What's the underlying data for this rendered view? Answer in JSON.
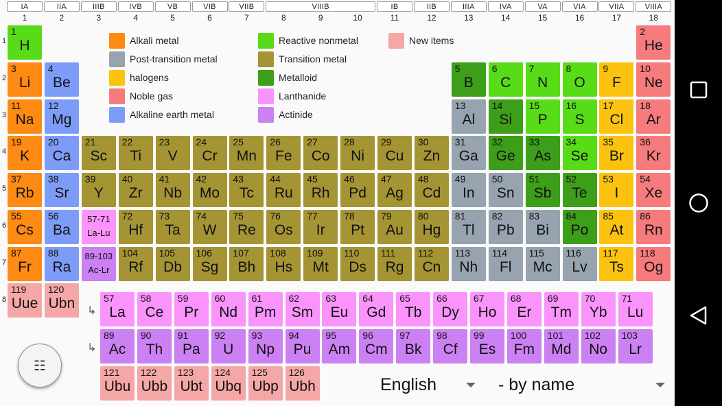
{
  "colors": {
    "alkali": "#fd8a12",
    "alkaline": "#7d9cf8",
    "transition": "#a49434",
    "post": "#97a3ae",
    "metalloid": "#3d9e19",
    "nonmetal": "#58dc17",
    "halogen": "#fbc30f",
    "noble": "#f67b7c",
    "lanth": "#fa93fb",
    "actin": "#cb80f3",
    "newitem": "#f4a7a6",
    "hydrogen": "#58dc17"
  },
  "group_labels": [
    "IA",
    "IIA",
    "IIIB",
    "IVB",
    "VB",
    "VIB",
    "VIIB",
    "VIIIB",
    "IB",
    "IIB",
    "IIIA",
    "IVA",
    "VA",
    "VIA",
    "VIIA",
    "VIIIA"
  ],
  "col_numbers": [
    "1",
    "2",
    "3",
    "4",
    "5",
    "6",
    "7",
    "8",
    "9",
    "10",
    "11",
    "12",
    "13",
    "14",
    "15",
    "16",
    "17",
    "18"
  ],
  "row_numbers": [
    "1",
    "2",
    "3",
    "4",
    "5",
    "6",
    "7",
    "8"
  ],
  "legend": [
    {
      "key": "alkali",
      "label": "Alkali metal"
    },
    {
      "key": "post",
      "label": "Post-transition metal"
    },
    {
      "key": "halogen",
      "label": "halogens"
    },
    {
      "key": "noble",
      "label": "Noble gas"
    },
    {
      "key": "alkaline",
      "label": "Alkaline earth metal"
    },
    {
      "key": "nonmetal",
      "label": "Reactive nonmetal"
    },
    {
      "key": "transition",
      "label": "Transition metal"
    },
    {
      "key": "metalloid",
      "label": "Metalloid"
    },
    {
      "key": "lanth",
      "label": "Lanthanide"
    },
    {
      "key": "actin",
      "label": "Actinide"
    },
    {
      "key": "newitem",
      "label": "New items"
    }
  ],
  "elements": [
    {
      "n": "1",
      "s": "H",
      "cat": "hydrogen",
      "r": 1,
      "c": 1
    },
    {
      "n": "2",
      "s": "He",
      "cat": "noble",
      "r": 1,
      "c": 18
    },
    {
      "n": "3",
      "s": "Li",
      "cat": "alkali",
      "r": 2,
      "c": 1
    },
    {
      "n": "4",
      "s": "Be",
      "cat": "alkaline",
      "r": 2,
      "c": 2
    },
    {
      "n": "5",
      "s": "B",
      "cat": "metalloid",
      "r": 2,
      "c": 13
    },
    {
      "n": "6",
      "s": "C",
      "cat": "nonmetal",
      "r": 2,
      "c": 14
    },
    {
      "n": "7",
      "s": "N",
      "cat": "nonmetal",
      "r": 2,
      "c": 15
    },
    {
      "n": "8",
      "s": "O",
      "cat": "nonmetal",
      "r": 2,
      "c": 16
    },
    {
      "n": "9",
      "s": "F",
      "cat": "halogen",
      "r": 2,
      "c": 17
    },
    {
      "n": "10",
      "s": "Ne",
      "cat": "noble",
      "r": 2,
      "c": 18
    },
    {
      "n": "11",
      "s": "Na",
      "cat": "alkali",
      "r": 3,
      "c": 1
    },
    {
      "n": "12",
      "s": "Mg",
      "cat": "alkaline",
      "r": 3,
      "c": 2
    },
    {
      "n": "13",
      "s": "Al",
      "cat": "post",
      "r": 3,
      "c": 13
    },
    {
      "n": "14",
      "s": "Si",
      "cat": "metalloid",
      "r": 3,
      "c": 14
    },
    {
      "n": "15",
      "s": "P",
      "cat": "nonmetal",
      "r": 3,
      "c": 15
    },
    {
      "n": "16",
      "s": "S",
      "cat": "nonmetal",
      "r": 3,
      "c": 16
    },
    {
      "n": "17",
      "s": "Cl",
      "cat": "halogen",
      "r": 3,
      "c": 17
    },
    {
      "n": "18",
      "s": "Ar",
      "cat": "noble",
      "r": 3,
      "c": 18
    },
    {
      "n": "19",
      "s": "K",
      "cat": "alkali",
      "r": 4,
      "c": 1
    },
    {
      "n": "20",
      "s": "Ca",
      "cat": "alkaline",
      "r": 4,
      "c": 2
    },
    {
      "n": "21",
      "s": "Sc",
      "cat": "transition",
      "r": 4,
      "c": 3
    },
    {
      "n": "22",
      "s": "Ti",
      "cat": "transition",
      "r": 4,
      "c": 4
    },
    {
      "n": "23",
      "s": "V",
      "cat": "transition",
      "r": 4,
      "c": 5
    },
    {
      "n": "24",
      "s": "Cr",
      "cat": "transition",
      "r": 4,
      "c": 6
    },
    {
      "n": "25",
      "s": "Mn",
      "cat": "transition",
      "r": 4,
      "c": 7
    },
    {
      "n": "26",
      "s": "Fe",
      "cat": "transition",
      "r": 4,
      "c": 8
    },
    {
      "n": "27",
      "s": "Co",
      "cat": "transition",
      "r": 4,
      "c": 9
    },
    {
      "n": "28",
      "s": "Ni",
      "cat": "transition",
      "r": 4,
      "c": 10
    },
    {
      "n": "29",
      "s": "Cu",
      "cat": "transition",
      "r": 4,
      "c": 11
    },
    {
      "n": "30",
      "s": "Zn",
      "cat": "transition",
      "r": 4,
      "c": 12
    },
    {
      "n": "31",
      "s": "Ga",
      "cat": "post",
      "r": 4,
      "c": 13
    },
    {
      "n": "32",
      "s": "Ge",
      "cat": "metalloid",
      "r": 4,
      "c": 14
    },
    {
      "n": "33",
      "s": "As",
      "cat": "metalloid",
      "r": 4,
      "c": 15
    },
    {
      "n": "34",
      "s": "Se",
      "cat": "nonmetal",
      "r": 4,
      "c": 16
    },
    {
      "n": "35",
      "s": "Br",
      "cat": "halogen",
      "r": 4,
      "c": 17
    },
    {
      "n": "36",
      "s": "Kr",
      "cat": "noble",
      "r": 4,
      "c": 18
    },
    {
      "n": "37",
      "s": "Rb",
      "cat": "alkali",
      "r": 5,
      "c": 1
    },
    {
      "n": "38",
      "s": "Sr",
      "cat": "alkaline",
      "r": 5,
      "c": 2
    },
    {
      "n": "39",
      "s": "Y",
      "cat": "transition",
      "r": 5,
      "c": 3
    },
    {
      "n": "40",
      "s": "Zr",
      "cat": "transition",
      "r": 5,
      "c": 4
    },
    {
      "n": "41",
      "s": "Nb",
      "cat": "transition",
      "r": 5,
      "c": 5
    },
    {
      "n": "42",
      "s": "Mo",
      "cat": "transition",
      "r": 5,
      "c": 6
    },
    {
      "n": "43",
      "s": "Tc",
      "cat": "transition",
      "r": 5,
      "c": 7
    },
    {
      "n": "44",
      "s": "Ru",
      "cat": "transition",
      "r": 5,
      "c": 8
    },
    {
      "n": "45",
      "s": "Rh",
      "cat": "transition",
      "r": 5,
      "c": 9
    },
    {
      "n": "46",
      "s": "Pd",
      "cat": "transition",
      "r": 5,
      "c": 10
    },
    {
      "n": "47",
      "s": "Ag",
      "cat": "transition",
      "r": 5,
      "c": 11
    },
    {
      "n": "48",
      "s": "Cd",
      "cat": "transition",
      "r": 5,
      "c": 12
    },
    {
      "n": "49",
      "s": "In",
      "cat": "post",
      "r": 5,
      "c": 13
    },
    {
      "n": "50",
      "s": "Sn",
      "cat": "post",
      "r": 5,
      "c": 14
    },
    {
      "n": "51",
      "s": "Sb",
      "cat": "metalloid",
      "r": 5,
      "c": 15
    },
    {
      "n": "52",
      "s": "Te",
      "cat": "metalloid",
      "r": 5,
      "c": 16
    },
    {
      "n": "53",
      "s": "I",
      "cat": "halogen",
      "r": 5,
      "c": 17
    },
    {
      "n": "54",
      "s": "Xe",
      "cat": "noble",
      "r": 5,
      "c": 18
    },
    {
      "n": "55",
      "s": "Cs",
      "cat": "alkali",
      "r": 6,
      "c": 1
    },
    {
      "n": "56",
      "s": "Ba",
      "cat": "alkaline",
      "r": 6,
      "c": 2
    },
    {
      "n": "57-71",
      "s": "La-Lu",
      "cat": "lanth",
      "r": 6,
      "c": 3,
      "range": true
    },
    {
      "n": "72",
      "s": "Hf",
      "cat": "transition",
      "r": 6,
      "c": 4
    },
    {
      "n": "73",
      "s": "Ta",
      "cat": "transition",
      "r": 6,
      "c": 5
    },
    {
      "n": "74",
      "s": "W",
      "cat": "transition",
      "r": 6,
      "c": 6
    },
    {
      "n": "75",
      "s": "Re",
      "cat": "transition",
      "r": 6,
      "c": 7
    },
    {
      "n": "76",
      "s": "Os",
      "cat": "transition",
      "r": 6,
      "c": 8
    },
    {
      "n": "77",
      "s": "Ir",
      "cat": "transition",
      "r": 6,
      "c": 9
    },
    {
      "n": "78",
      "s": "Pt",
      "cat": "transition",
      "r": 6,
      "c": 10
    },
    {
      "n": "79",
      "s": "Au",
      "cat": "transition",
      "r": 6,
      "c": 11
    },
    {
      "n": "80",
      "s": "Hg",
      "cat": "transition",
      "r": 6,
      "c": 12
    },
    {
      "n": "81",
      "s": "Tl",
      "cat": "post",
      "r": 6,
      "c": 13
    },
    {
      "n": "82",
      "s": "Pb",
      "cat": "post",
      "r": 6,
      "c": 14
    },
    {
      "n": "83",
      "s": "Bi",
      "cat": "post",
      "r": 6,
      "c": 15
    },
    {
      "n": "84",
      "s": "Po",
      "cat": "metalloid",
      "r": 6,
      "c": 16
    },
    {
      "n": "85",
      "s": "At",
      "cat": "halogen",
      "r": 6,
      "c": 17
    },
    {
      "n": "86",
      "s": "Rn",
      "cat": "noble",
      "r": 6,
      "c": 18
    },
    {
      "n": "87",
      "s": "Fr",
      "cat": "alkali",
      "r": 7,
      "c": 1
    },
    {
      "n": "88",
      "s": "Ra",
      "cat": "alkaline",
      "r": 7,
      "c": 2
    },
    {
      "n": "89-103",
      "s": "Ac-Lr",
      "cat": "actin",
      "r": 7,
      "c": 3,
      "range": true
    },
    {
      "n": "104",
      "s": "Rf",
      "cat": "transition",
      "r": 7,
      "c": 4
    },
    {
      "n": "105",
      "s": "Db",
      "cat": "transition",
      "r": 7,
      "c": 5
    },
    {
      "n": "106",
      "s": "Sg",
      "cat": "transition",
      "r": 7,
      "c": 6
    },
    {
      "n": "107",
      "s": "Bh",
      "cat": "transition",
      "r": 7,
      "c": 7
    },
    {
      "n": "108",
      "s": "Hs",
      "cat": "transition",
      "r": 7,
      "c": 8
    },
    {
      "n": "109",
      "s": "Mt",
      "cat": "transition",
      "r": 7,
      "c": 9
    },
    {
      "n": "110",
      "s": "Ds",
      "cat": "transition",
      "r": 7,
      "c": 10
    },
    {
      "n": "111",
      "s": "Rg",
      "cat": "transition",
      "r": 7,
      "c": 11
    },
    {
      "n": "112",
      "s": "Cn",
      "cat": "transition",
      "r": 7,
      "c": 12
    },
    {
      "n": "113",
      "s": "Nh",
      "cat": "post",
      "r": 7,
      "c": 13
    },
    {
      "n": "114",
      "s": "Fl",
      "cat": "post",
      "r": 7,
      "c": 14
    },
    {
      "n": "115",
      "s": "Mc",
      "cat": "post",
      "r": 7,
      "c": 15
    },
    {
      "n": "116",
      "s": "Lv",
      "cat": "post",
      "r": 7,
      "c": 16
    },
    {
      "n": "117",
      "s": "Ts",
      "cat": "halogen",
      "r": 7,
      "c": 17
    },
    {
      "n": "118",
      "s": "Og",
      "cat": "noble",
      "r": 7,
      "c": 18
    },
    {
      "n": "119",
      "s": "Uue",
      "cat": "newitem",
      "r": 8,
      "c": 1
    },
    {
      "n": "120",
      "s": "Ubn",
      "cat": "newitem",
      "r": 8,
      "c": 2
    }
  ],
  "lanthanides": [
    {
      "n": "57",
      "s": "La"
    },
    {
      "n": "58",
      "s": "Ce"
    },
    {
      "n": "59",
      "s": "Pr"
    },
    {
      "n": "60",
      "s": "Nd"
    },
    {
      "n": "61",
      "s": "Pm"
    },
    {
      "n": "62",
      "s": "Sm"
    },
    {
      "n": "63",
      "s": "Eu"
    },
    {
      "n": "64",
      "s": "Gd"
    },
    {
      "n": "65",
      "s": "Tb"
    },
    {
      "n": "66",
      "s": "Dy"
    },
    {
      "n": "67",
      "s": "Ho"
    },
    {
      "n": "68",
      "s": "Er"
    },
    {
      "n": "69",
      "s": "Tm"
    },
    {
      "n": "70",
      "s": "Yb"
    },
    {
      "n": "71",
      "s": "Lu"
    }
  ],
  "actinides": [
    {
      "n": "89",
      "s": "Ac"
    },
    {
      "n": "90",
      "s": "Th"
    },
    {
      "n": "91",
      "s": "Pa"
    },
    {
      "n": "92",
      "s": "U"
    },
    {
      "n": "93",
      "s": "Np"
    },
    {
      "n": "94",
      "s": "Pu"
    },
    {
      "n": "95",
      "s": "Am"
    },
    {
      "n": "96",
      "s": "Cm"
    },
    {
      "n": "97",
      "s": "Bk"
    },
    {
      "n": "98",
      "s": "Cf"
    },
    {
      "n": "99",
      "s": "Es"
    },
    {
      "n": "100",
      "s": "Fm"
    },
    {
      "n": "101",
      "s": "Md"
    },
    {
      "n": "102",
      "s": "No"
    },
    {
      "n": "103",
      "s": "Lr"
    }
  ],
  "new_items_row": [
    {
      "n": "121",
      "s": "Ubu"
    },
    {
      "n": "122",
      "s": "Ubb"
    },
    {
      "n": "123",
      "s": "Ubt"
    },
    {
      "n": "124",
      "s": "Ubq"
    },
    {
      "n": "125",
      "s": "Ubp"
    },
    {
      "n": "126",
      "s": "Ubh"
    }
  ],
  "arrow_glyph": "↳",
  "menu_icon": "☷",
  "language_dropdown": {
    "value": "English"
  },
  "sort_dropdown": {
    "value": "- by name"
  },
  "navbar_icons": [
    "square-icon",
    "circle-icon",
    "back-triangle-icon"
  ]
}
